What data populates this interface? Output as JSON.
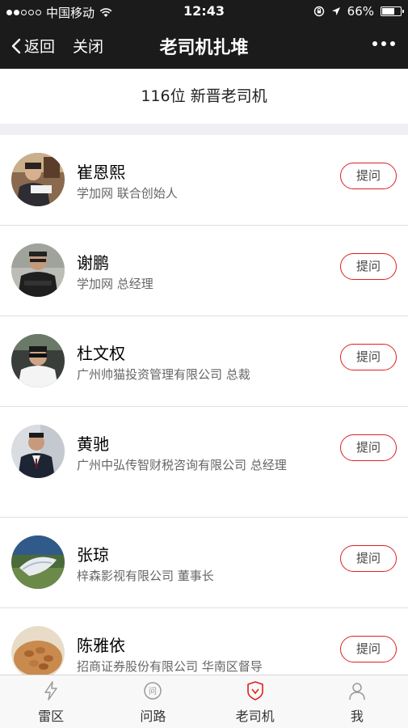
{
  "status_bar": {
    "carrier": "中国移动",
    "time": "12:43",
    "battery": "66%",
    "battery_level": 0.66,
    "signal_full_dots": 2,
    "signal_total_dots": 5
  },
  "nav": {
    "back_label": "返回",
    "close_label": "关闭",
    "title": "老司机扎堆"
  },
  "header": {
    "count_text": "116位 新晋老司机"
  },
  "drivers": [
    {
      "name": "崔恩熙",
      "title": "学加网 联合创始人",
      "button": "提问"
    },
    {
      "name": "谢鹏",
      "title": "学加网 总经理",
      "button": "提问"
    },
    {
      "name": "杜文权",
      "title": "广州帅猫投资管理有限公司 总裁",
      "button": "提问"
    },
    {
      "name": "黄驰",
      "title": "广州中弘传智财税咨询有限公司 总经理",
      "button": "提问"
    },
    {
      "name": "张琼",
      "title": "梓森影视有限公司 董事长",
      "button": "提问"
    },
    {
      "name": "陈雅依",
      "title": "招商证券股份有限公司 华南区督导",
      "button": "提问"
    }
  ],
  "tabs": [
    {
      "label": "雷区",
      "icon": "lightning-icon"
    },
    {
      "label": "问路",
      "icon": "question-bubble-icon"
    },
    {
      "label": "老司机",
      "icon": "driver-badge-icon",
      "active": true
    },
    {
      "label": "我",
      "icon": "person-icon"
    }
  ],
  "colors": {
    "bar_background": "#1b1b1c",
    "accent_red": "#e02020",
    "gap_gray": "#efeff4",
    "tab_active_icon": "#e02020"
  }
}
